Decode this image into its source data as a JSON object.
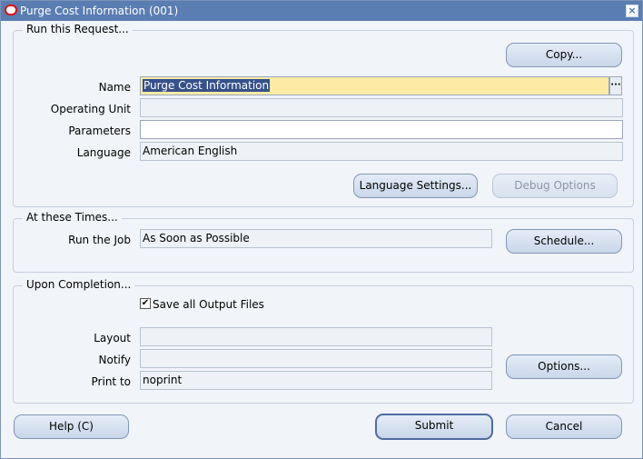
{
  "window": {
    "title": "Purge Cost Information (001)",
    "close_glyph": "×"
  },
  "run_request": {
    "legend": "Run this Request...",
    "copy_button": "Copy...",
    "name_label": "Name",
    "name_value": "Purge Cost Information",
    "lov_glyph": "···",
    "operating_unit_label": "Operating Unit",
    "operating_unit_value": "",
    "parameters_label": "Parameters",
    "parameters_value": "",
    "language_label": "Language",
    "language_value": "American English",
    "language_settings_button": "Language Settings...",
    "debug_options_button": "Debug Options"
  },
  "at_these_times": {
    "legend": "At these Times...",
    "run_job_label": "Run the Job",
    "run_job_value": "As Soon as Possible",
    "schedule_button": "Schedule..."
  },
  "upon_completion": {
    "legend": "Upon Completion...",
    "save_output_label": "Save all Output Files",
    "save_output_checked": true,
    "layout_label": "Layout",
    "layout_value": "",
    "notify_label": "Notify",
    "notify_value": "",
    "print_to_label": "Print to",
    "print_to_value": "noprint",
    "options_button": "Options..."
  },
  "footer": {
    "help_button": "Help (C)",
    "submit_button": "Submit",
    "cancel_button": "Cancel"
  },
  "colors": {
    "titlebar": "#5a7db2",
    "background": "#f1f4f9",
    "active_field": "#fbe9a4",
    "selection": "#36518a"
  }
}
